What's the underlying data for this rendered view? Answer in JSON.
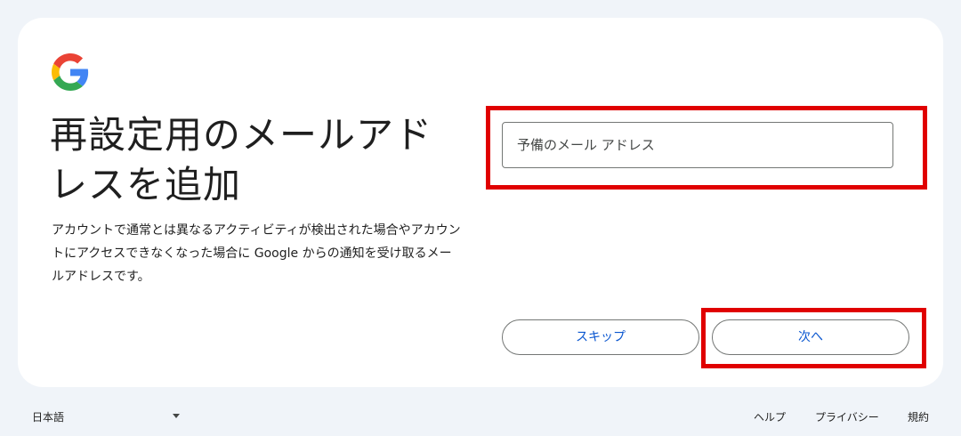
{
  "title": "再設定用のメールアドレスを追加",
  "description": "アカウントで通常とは異なるアクティビティが検出された場合やアカウントにアクセスできなくなった場合に Google からの通知を受け取るメールアドレスです。",
  "email_input": {
    "placeholder": "予備のメール アドレス",
    "value": ""
  },
  "buttons": {
    "skip_label": "スキップ",
    "next_label": "次へ"
  },
  "footer": {
    "language": "日本語",
    "help": "ヘルプ",
    "privacy": "プライバシー",
    "terms": "規約"
  },
  "colors": {
    "page_bg": "#f0f4f9",
    "card_bg": "#ffffff",
    "button_text": "#0b57d0",
    "highlight": "#e00000",
    "google_blue": "#4285f4",
    "google_red": "#ea4335",
    "google_yellow": "#fbbc05",
    "google_green": "#34a853"
  },
  "icons": {
    "logo": "google-g-icon",
    "language_dropdown": "caret-down-icon"
  }
}
